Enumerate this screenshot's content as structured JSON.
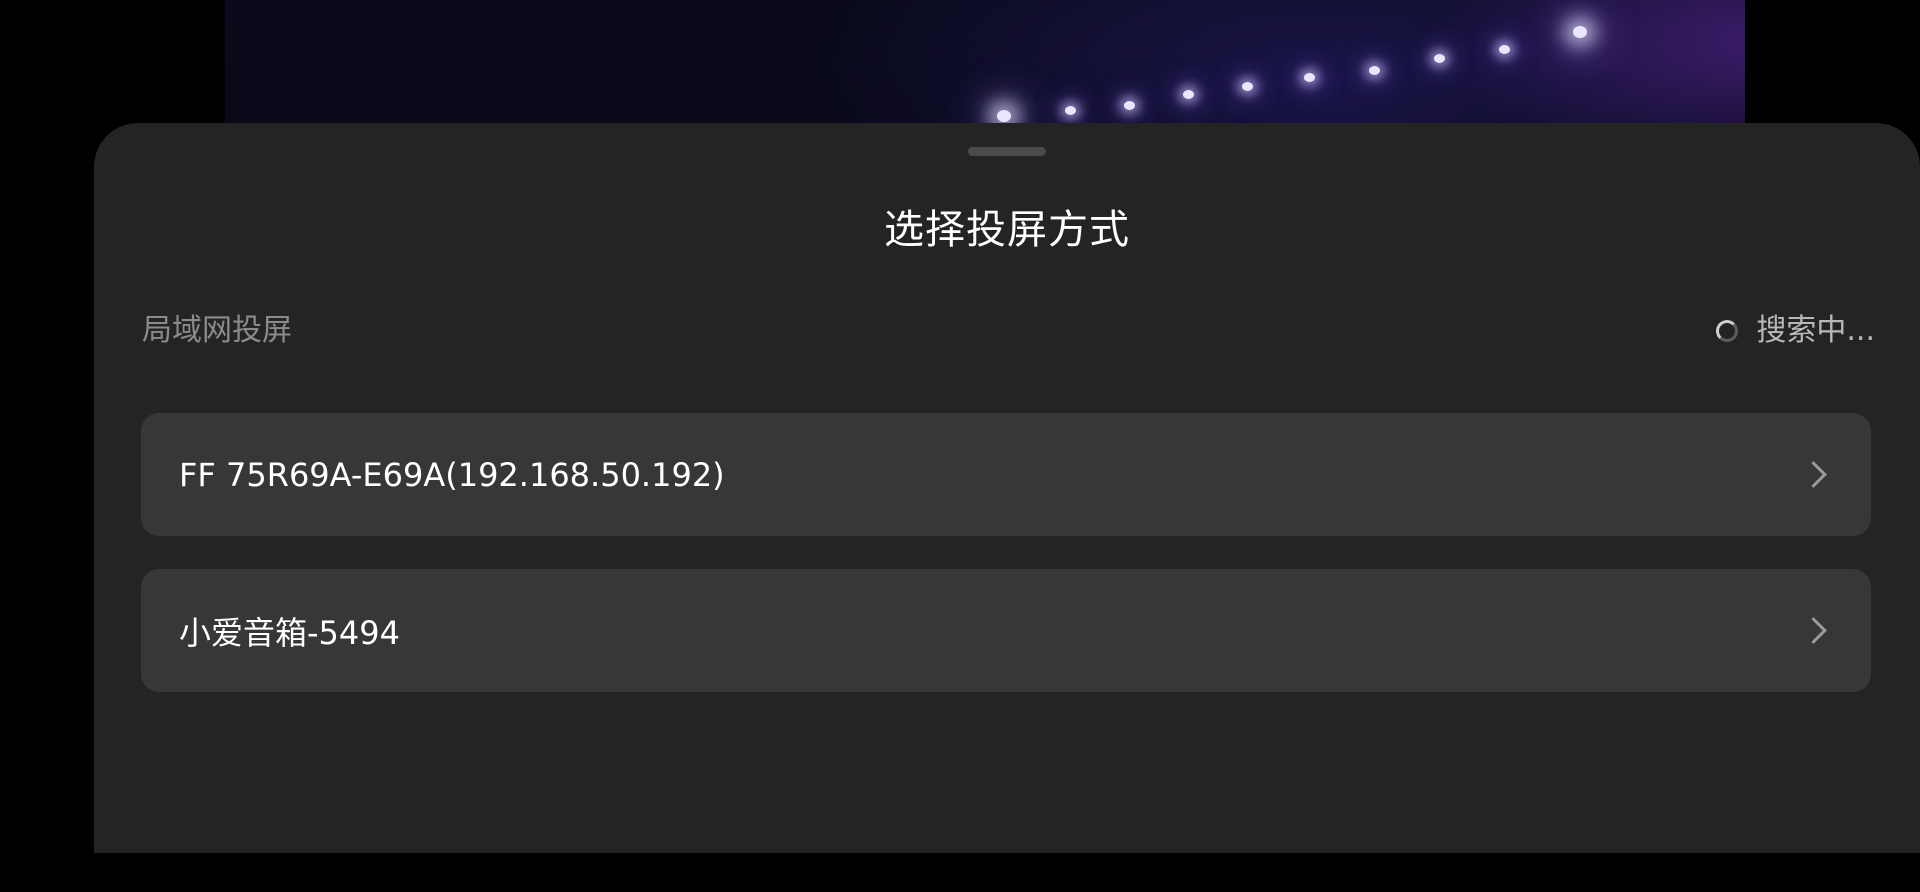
{
  "sheet": {
    "title": "选择投屏方式",
    "section_label": "局域网投屏",
    "status_text": "搜索中...",
    "status_icon": "loading-spinner-icon"
  },
  "devices": [
    {
      "name": "FF 75R69A-E69A(192.168.50.192)",
      "icon": "chevron-right-icon"
    },
    {
      "name": "小爱音箱-5494",
      "icon": "chevron-right-icon"
    }
  ],
  "colors": {
    "sheet_background": "#242424",
    "item_background": "#373737",
    "title_text": "#ffffff",
    "section_text": "#8b8b8b",
    "page_background": "#000000"
  }
}
